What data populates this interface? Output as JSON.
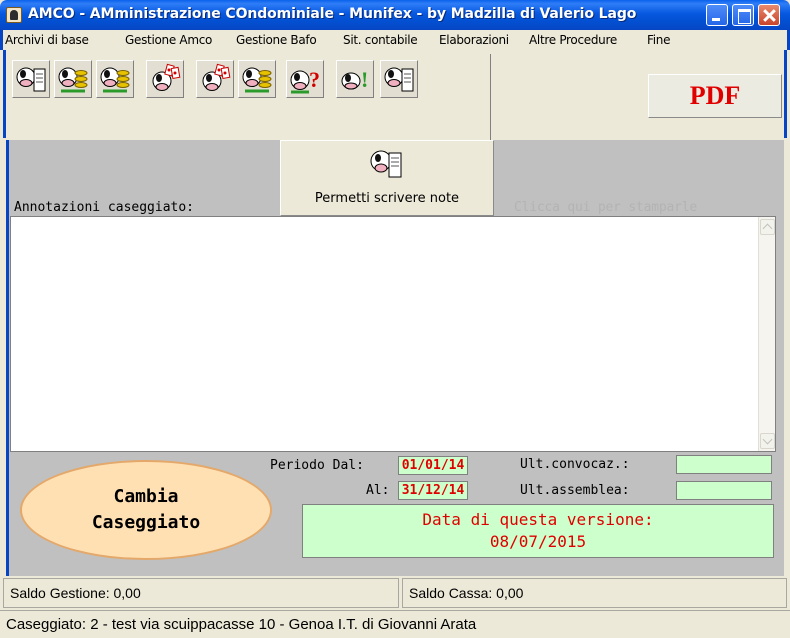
{
  "window": {
    "title": "AMCO - AMministrazione COndominiale - Munifex - by  Madzilla di Valerio Lago"
  },
  "menu": {
    "items": [
      "Archivi di base",
      "Gestione Amco",
      "Gestione Bafo",
      "Sit. contabile",
      "Elaborazioni",
      "Altre Procedure",
      "Fine"
    ]
  },
  "toolbar": {
    "icons": [
      "cow-book-icon",
      "cow-coins-icon",
      "cow-coins-icon",
      "cow-cards-icon",
      "cow-cards-icon",
      "cow-coins-icon",
      "cow-question-icon",
      "cow-exclaim-icon",
      "cow-book-icon"
    ],
    "pdf_label": "PDF"
  },
  "notes": {
    "label": "Annotazioni caseggiato:",
    "allow_button_label": "Permetti scrivere note",
    "print_link": "Clicca qui per stamparle",
    "content": ""
  },
  "period": {
    "from_label": "Periodo Dal:",
    "from_value": "01/01/14",
    "to_label": "Al:",
    "to_value": "31/12/14",
    "convocation_label": "Ult.convocaz.:",
    "convocation_value": "",
    "assembly_label": "Ult.assemblea:",
    "assembly_value": ""
  },
  "change_building": {
    "line1": "Cambia",
    "line2": "Caseggiato"
  },
  "version": {
    "line1": "Data di questa versione:",
    "line2": "08/07/2015"
  },
  "status": {
    "saldo_gestione": "Saldo Gestione: 0,00",
    "saldo_cassa": "Saldo Cassa: 0,00",
    "caseggiato": "Caseggiato: 2 - test  via scuippacasse 10 - Genoa I.T. di Giovanni Arata"
  },
  "colors": {
    "titlebar": "#0646c4",
    "accent_red": "#e00000",
    "field_green": "#ccffcc",
    "change_button": "#ffe0b3",
    "panel_gray": "#c0c0c0"
  }
}
